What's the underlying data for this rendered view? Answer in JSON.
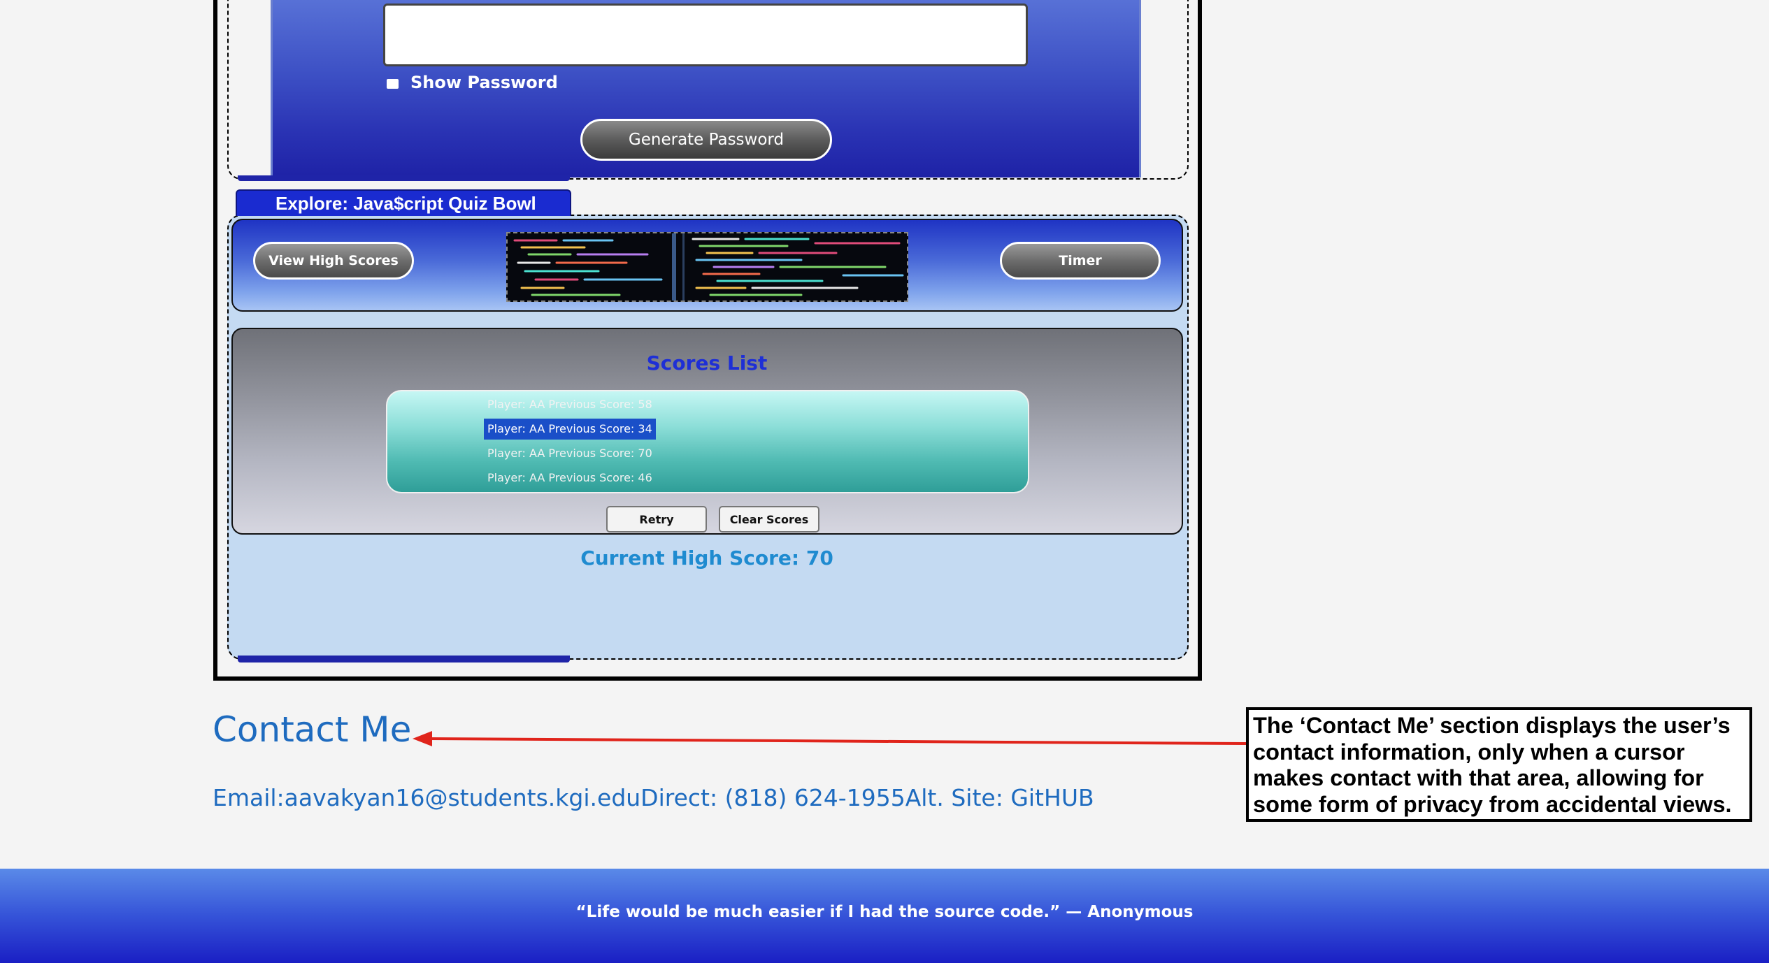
{
  "password_generator": {
    "show_password_label": "Show Password",
    "generate_button": "Generate Password"
  },
  "quiz": {
    "tab_label": "Explore: Java$cript Quiz Bowl",
    "view_high_scores_button": "View High Scores",
    "timer_button": "Timer",
    "scores_title": "Scores List",
    "scores": [
      "Player: AA Previous Score: 58",
      "Player: AA Previous Score: 34",
      "Player: AA Previous Score: 70",
      "Player: AA Previous Score: 46"
    ],
    "selected_score_index": 1,
    "retry_button": "Retry",
    "clear_scores_button": "Clear Scores",
    "current_high_score": "Current High Score: 70"
  },
  "contact": {
    "title": "Contact Me",
    "details": "Email:aavakyan16@students.kgi.eduDirect: (818) 624-1955Alt. Site: GitHUB"
  },
  "annotation": {
    "text": "The ‘Contact Me’ section displays the user’s contact information, only when a cursor makes contact with that area, allowing for some form of privacy from accidental views.",
    "lines": [
      "The ‘Contact Me’ section displays the user’s",
      "contact information, only when a cursor",
      "makes contact with that area, allowing for",
      "some form of privacy from accidental views."
    ],
    "arrow_color": "#e0241b"
  },
  "footer": {
    "quote": "“Life would be much easier if I had the source code.” — Anonymous"
  },
  "colors": {
    "accent_blue": "#1e6bbf",
    "scores_title": "#1e2fd6",
    "high_score": "#1f8bd0",
    "selected_row": "#1a4fc8"
  }
}
